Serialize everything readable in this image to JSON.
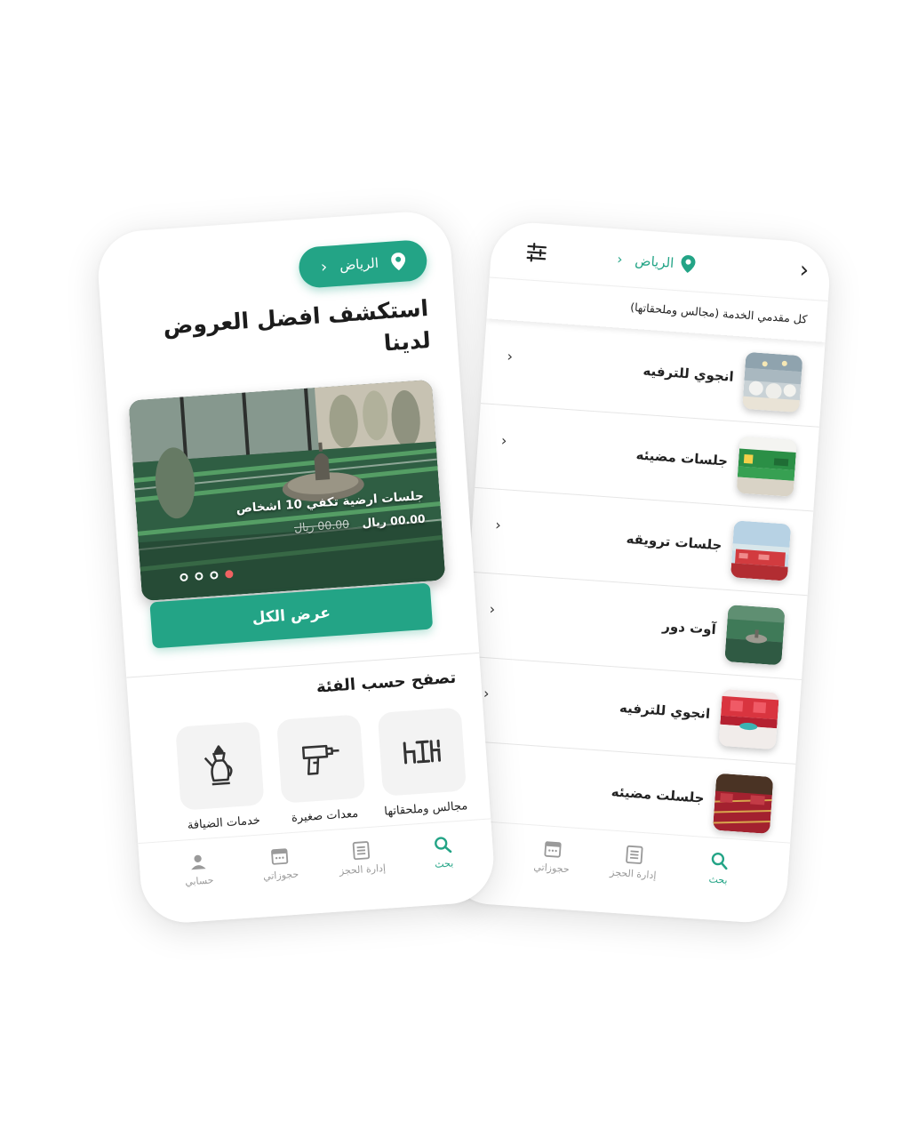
{
  "colors": {
    "accent": "#23a486",
    "indicator": "#f06262"
  },
  "right_screen": {
    "city": "الرياض",
    "filter_icon": "sliders-icon",
    "subtitle": "كل مقدمي الخدمة (مجالس وملحقاتها)",
    "providers": [
      {
        "name": "انجوي للترفيه",
        "thumb": "hall-icon"
      },
      {
        "name": "جلسات مضيئه",
        "thumb": "green-seating-icon"
      },
      {
        "name": "جلسات ترويقه",
        "thumb": "red-seating-icon"
      },
      {
        "name": "آوت دور",
        "thumb": "outdoor-seating-icon"
      },
      {
        "name": "انجوي للترفيه",
        "thumb": "red-cushions-icon"
      },
      {
        "name": "جلسلت مضيئه",
        "thumb": "carpet-icon"
      }
    ],
    "tabs": {
      "search": "بحث",
      "manage": "إدارة الحجز",
      "bookings": "حجوزاتي"
    }
  },
  "left_screen": {
    "city": "الرياض",
    "headline": "استكشف افضل العروض لدينا",
    "offer": {
      "title": "جلسات ارضية تكفي 10 اشخاص",
      "price": "00.00 ريال",
      "old_price": "00.00 ريال"
    },
    "view_all": "عرض الكل",
    "browse_title": "تصفح حسب الفئة",
    "categories": [
      {
        "label": "مجالس وملحقاتها",
        "icon": "majlis-icon"
      },
      {
        "label": "معدات صغيرة",
        "icon": "drill-icon"
      },
      {
        "label": "خدمات الضيافة",
        "icon": "dallah-icon"
      }
    ],
    "tabs": {
      "search": "بحث",
      "manage": "إدارة الحجز",
      "bookings": "حجوزاتي",
      "account": "حسابي"
    }
  }
}
